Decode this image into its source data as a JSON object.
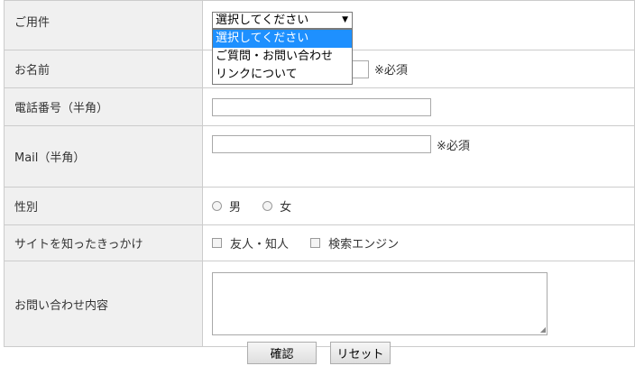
{
  "form": {
    "purpose": {
      "label": "ご用件",
      "selected": "選択してください",
      "options": [
        "選択してください",
        "ご質問・お問い合わせ",
        "リンクについて"
      ]
    },
    "name": {
      "label": "お名前",
      "required": "※必須"
    },
    "phone": {
      "label": "電話番号（半角）"
    },
    "mail": {
      "label": "Mail（半角）",
      "required": "※必須"
    },
    "gender": {
      "label": "性別",
      "options": [
        "男",
        "女"
      ]
    },
    "source": {
      "label": "サイトを知ったきっかけ",
      "options": [
        "友人・知人",
        "検索エンジン"
      ]
    },
    "inquiry": {
      "label": "お問い合わせ内容"
    }
  },
  "buttons": {
    "confirm": "確認",
    "reset": "リセット"
  }
}
